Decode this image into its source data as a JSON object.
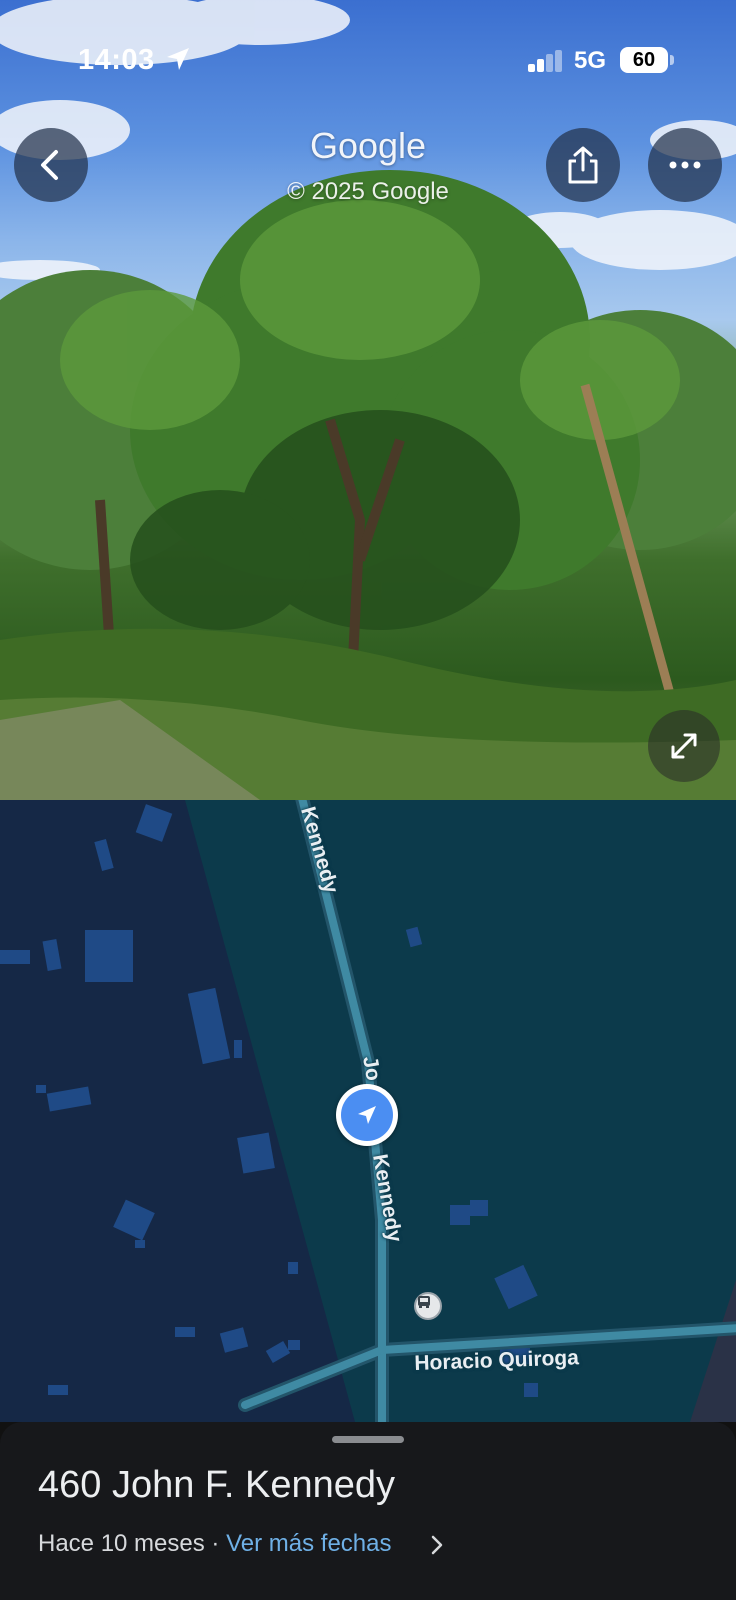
{
  "status_bar": {
    "time": "14:03",
    "network": "5G",
    "battery": "60"
  },
  "street_view": {
    "brand": "Google",
    "copyright": "© 2025 Google",
    "buttons": {
      "back": "chevron-left-icon",
      "share": "share-icon",
      "more": "more-horizontal-icon",
      "expand": "expand-icon"
    }
  },
  "map": {
    "streets": {
      "kennedy_top": "Kennedy",
      "jo": "Jo",
      "kennedy_mid": "Kennedy",
      "horacio": "Horacio Quiroga"
    },
    "colors": {
      "water_area": "#0c3a4b",
      "land_area": "#152846",
      "road": "#3f8aa3",
      "buildings": "#1f4a86",
      "location": "#4b8ef2"
    }
  },
  "sheet": {
    "address": "460 John F. Kennedy",
    "date_text": "Hace 10 meses",
    "separator": "·",
    "more_dates_link": "Ver más fechas"
  }
}
